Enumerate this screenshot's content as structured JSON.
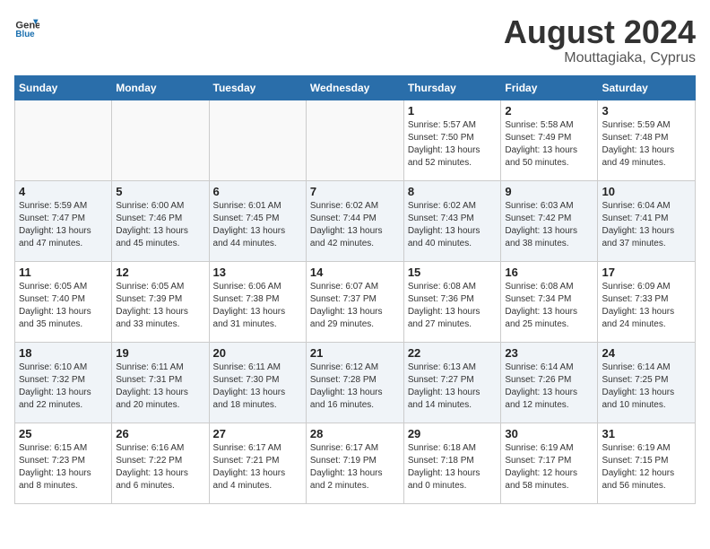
{
  "header": {
    "logo_general": "General",
    "logo_blue": "Blue",
    "month_year": "August 2024",
    "location": "Mouttagiaka, Cyprus"
  },
  "weekdays": [
    "Sunday",
    "Monday",
    "Tuesday",
    "Wednesday",
    "Thursday",
    "Friday",
    "Saturday"
  ],
  "weeks": [
    [
      {
        "day": "",
        "info": ""
      },
      {
        "day": "",
        "info": ""
      },
      {
        "day": "",
        "info": ""
      },
      {
        "day": "",
        "info": ""
      },
      {
        "day": "1",
        "info": "Sunrise: 5:57 AM\nSunset: 7:50 PM\nDaylight: 13 hours\nand 52 minutes."
      },
      {
        "day": "2",
        "info": "Sunrise: 5:58 AM\nSunset: 7:49 PM\nDaylight: 13 hours\nand 50 minutes."
      },
      {
        "day": "3",
        "info": "Sunrise: 5:59 AM\nSunset: 7:48 PM\nDaylight: 13 hours\nand 49 minutes."
      }
    ],
    [
      {
        "day": "4",
        "info": "Sunrise: 5:59 AM\nSunset: 7:47 PM\nDaylight: 13 hours\nand 47 minutes."
      },
      {
        "day": "5",
        "info": "Sunrise: 6:00 AM\nSunset: 7:46 PM\nDaylight: 13 hours\nand 45 minutes."
      },
      {
        "day": "6",
        "info": "Sunrise: 6:01 AM\nSunset: 7:45 PM\nDaylight: 13 hours\nand 44 minutes."
      },
      {
        "day": "7",
        "info": "Sunrise: 6:02 AM\nSunset: 7:44 PM\nDaylight: 13 hours\nand 42 minutes."
      },
      {
        "day": "8",
        "info": "Sunrise: 6:02 AM\nSunset: 7:43 PM\nDaylight: 13 hours\nand 40 minutes."
      },
      {
        "day": "9",
        "info": "Sunrise: 6:03 AM\nSunset: 7:42 PM\nDaylight: 13 hours\nand 38 minutes."
      },
      {
        "day": "10",
        "info": "Sunrise: 6:04 AM\nSunset: 7:41 PM\nDaylight: 13 hours\nand 37 minutes."
      }
    ],
    [
      {
        "day": "11",
        "info": "Sunrise: 6:05 AM\nSunset: 7:40 PM\nDaylight: 13 hours\nand 35 minutes."
      },
      {
        "day": "12",
        "info": "Sunrise: 6:05 AM\nSunset: 7:39 PM\nDaylight: 13 hours\nand 33 minutes."
      },
      {
        "day": "13",
        "info": "Sunrise: 6:06 AM\nSunset: 7:38 PM\nDaylight: 13 hours\nand 31 minutes."
      },
      {
        "day": "14",
        "info": "Sunrise: 6:07 AM\nSunset: 7:37 PM\nDaylight: 13 hours\nand 29 minutes."
      },
      {
        "day": "15",
        "info": "Sunrise: 6:08 AM\nSunset: 7:36 PM\nDaylight: 13 hours\nand 27 minutes."
      },
      {
        "day": "16",
        "info": "Sunrise: 6:08 AM\nSunset: 7:34 PM\nDaylight: 13 hours\nand 25 minutes."
      },
      {
        "day": "17",
        "info": "Sunrise: 6:09 AM\nSunset: 7:33 PM\nDaylight: 13 hours\nand 24 minutes."
      }
    ],
    [
      {
        "day": "18",
        "info": "Sunrise: 6:10 AM\nSunset: 7:32 PM\nDaylight: 13 hours\nand 22 minutes."
      },
      {
        "day": "19",
        "info": "Sunrise: 6:11 AM\nSunset: 7:31 PM\nDaylight: 13 hours\nand 20 minutes."
      },
      {
        "day": "20",
        "info": "Sunrise: 6:11 AM\nSunset: 7:30 PM\nDaylight: 13 hours\nand 18 minutes."
      },
      {
        "day": "21",
        "info": "Sunrise: 6:12 AM\nSunset: 7:28 PM\nDaylight: 13 hours\nand 16 minutes."
      },
      {
        "day": "22",
        "info": "Sunrise: 6:13 AM\nSunset: 7:27 PM\nDaylight: 13 hours\nand 14 minutes."
      },
      {
        "day": "23",
        "info": "Sunrise: 6:14 AM\nSunset: 7:26 PM\nDaylight: 13 hours\nand 12 minutes."
      },
      {
        "day": "24",
        "info": "Sunrise: 6:14 AM\nSunset: 7:25 PM\nDaylight: 13 hours\nand 10 minutes."
      }
    ],
    [
      {
        "day": "25",
        "info": "Sunrise: 6:15 AM\nSunset: 7:23 PM\nDaylight: 13 hours\nand 8 minutes."
      },
      {
        "day": "26",
        "info": "Sunrise: 6:16 AM\nSunset: 7:22 PM\nDaylight: 13 hours\nand 6 minutes."
      },
      {
        "day": "27",
        "info": "Sunrise: 6:17 AM\nSunset: 7:21 PM\nDaylight: 13 hours\nand 4 minutes."
      },
      {
        "day": "28",
        "info": "Sunrise: 6:17 AM\nSunset: 7:19 PM\nDaylight: 13 hours\nand 2 minutes."
      },
      {
        "day": "29",
        "info": "Sunrise: 6:18 AM\nSunset: 7:18 PM\nDaylight: 13 hours\nand 0 minutes."
      },
      {
        "day": "30",
        "info": "Sunrise: 6:19 AM\nSunset: 7:17 PM\nDaylight: 12 hours\nand 58 minutes."
      },
      {
        "day": "31",
        "info": "Sunrise: 6:19 AM\nSunset: 7:15 PM\nDaylight: 12 hours\nand 56 minutes."
      }
    ]
  ]
}
